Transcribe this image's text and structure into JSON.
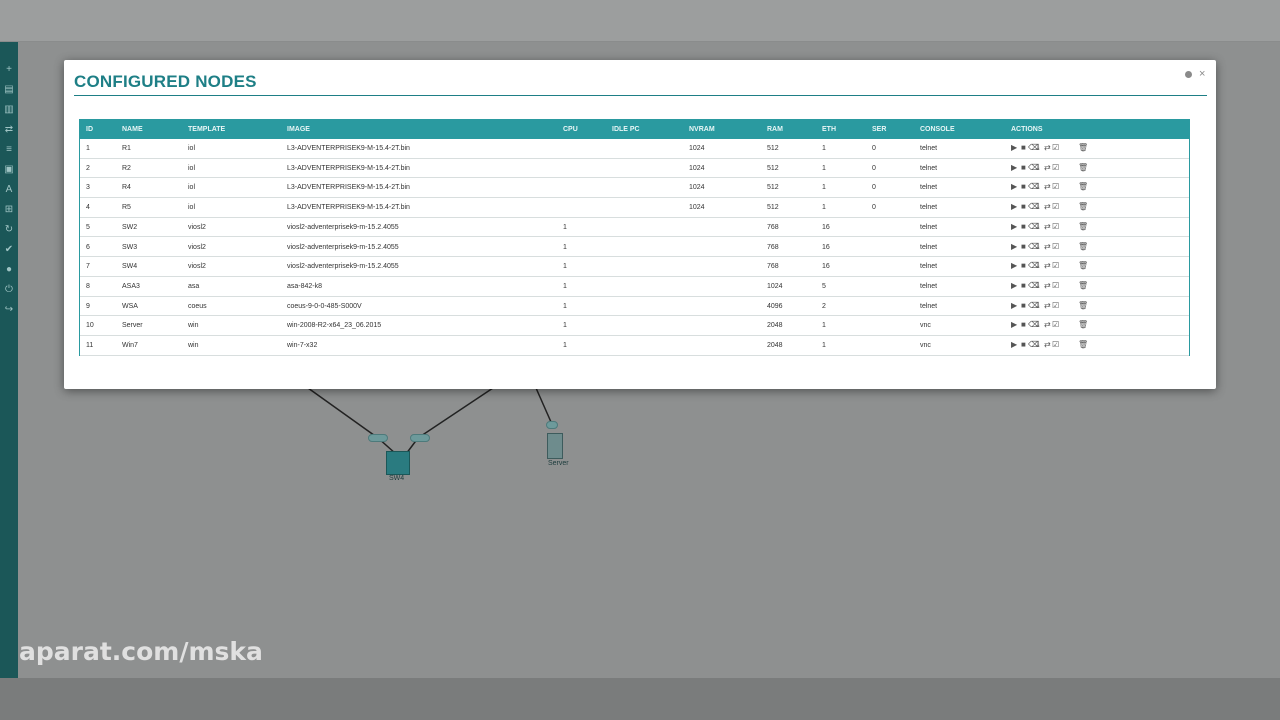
{
  "modal": {
    "title": "CONFIGURED NODES",
    "close_label": "×"
  },
  "table": {
    "headers": [
      "ID",
      "NAME",
      "TEMPLATE",
      "IMAGE",
      "CPU",
      "IDLE PC",
      "NVRAM",
      "RAM",
      "ETH",
      "SER",
      "CONSOLE",
      "ACTIONS"
    ],
    "rows": [
      [
        "1",
        "R1",
        "iol",
        "L3-ADVENTERPRISEK9-M-15.4-2T.bin",
        "",
        "",
        "1024",
        "512",
        "1",
        "0",
        "telnet"
      ],
      [
        "2",
        "R2",
        "iol",
        "L3-ADVENTERPRISEK9-M-15.4-2T.bin",
        "",
        "",
        "1024",
        "512",
        "1",
        "0",
        "telnet"
      ],
      [
        "3",
        "R4",
        "iol",
        "L3-ADVENTERPRISEK9-M-15.4-2T.bin",
        "",
        "",
        "1024",
        "512",
        "1",
        "0",
        "telnet"
      ],
      [
        "4",
        "R5",
        "iol",
        "L3-ADVENTERPRISEK9-M-15.4-2T.bin",
        "",
        "",
        "1024",
        "512",
        "1",
        "0",
        "telnet"
      ],
      [
        "5",
        "SW2",
        "viosl2",
        "viosl2-adventerprisek9-m-15.2.4055",
        "1",
        "",
        "",
        "768",
        "16",
        "",
        "telnet"
      ],
      [
        "6",
        "SW3",
        "viosl2",
        "viosl2-adventerprisek9-m-15.2.4055",
        "1",
        "",
        "",
        "768",
        "16",
        "",
        "telnet"
      ],
      [
        "7",
        "SW4",
        "viosl2",
        "viosl2-adventerprisek9-m-15.2.4055",
        "1",
        "",
        "",
        "768",
        "16",
        "",
        "telnet"
      ],
      [
        "8",
        "ASA3",
        "asa",
        "asa-842-k8",
        "1",
        "",
        "",
        "1024",
        "5",
        "",
        "telnet"
      ],
      [
        "9",
        "WSA",
        "coeus",
        "coeus-9-0-0-485-S000V",
        "1",
        "",
        "",
        "4096",
        "2",
        "",
        "telnet"
      ],
      [
        "10",
        "Server",
        "win",
        "win-2008-R2-x64_23_06.2015",
        "1",
        "",
        "",
        "2048",
        "1",
        "",
        "vnc"
      ],
      [
        "11",
        "Win7",
        "win",
        "win-7-x32",
        "1",
        "",
        "",
        "2048",
        "1",
        "",
        "vnc"
      ]
    ],
    "actions": [
      "start",
      "stop",
      "wipe",
      "export",
      "interfaces",
      "edit",
      "delete"
    ]
  },
  "topology": {
    "sw4_label": "SW4",
    "server_label": "Server"
  },
  "watermark": "aparat.com/mska",
  "colors": {
    "accent": "#1e7f86",
    "header_bg": "#2a9aa0",
    "sidebar": "#1b5758"
  }
}
